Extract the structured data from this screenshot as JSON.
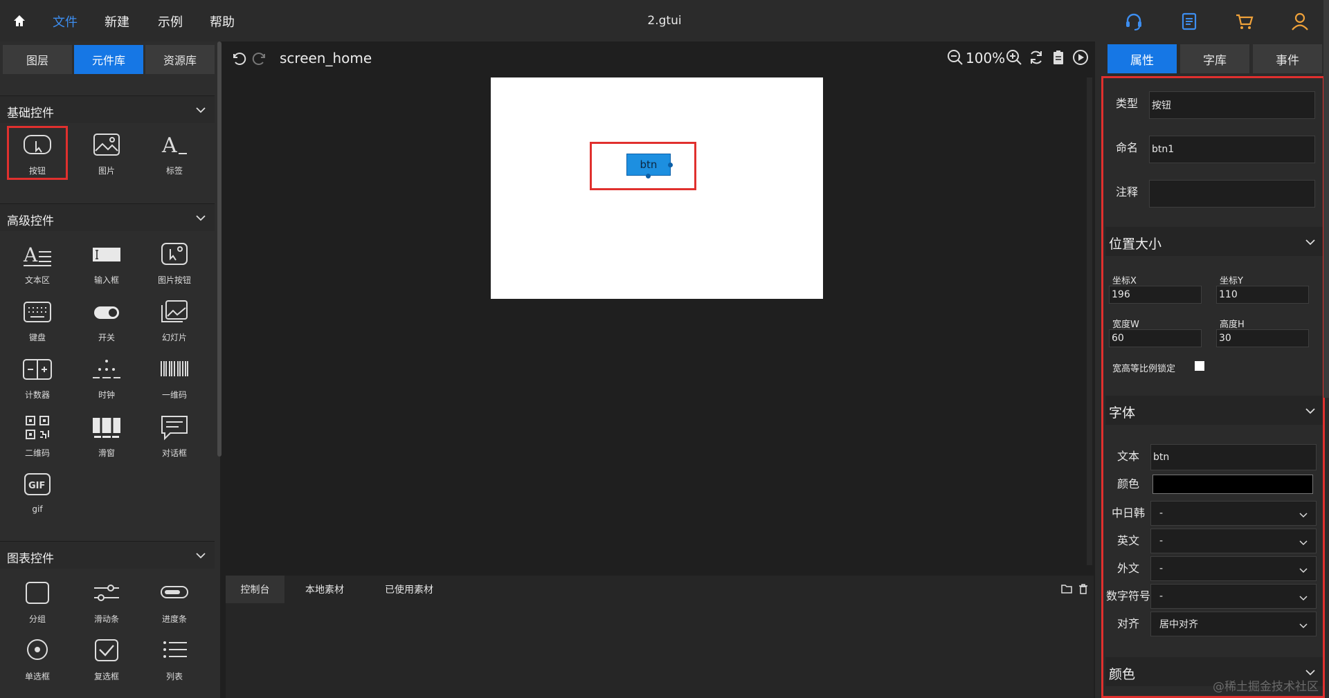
{
  "topbar": {
    "menus": [
      "文件",
      "新建",
      "示例",
      "帮助"
    ],
    "title": "2.gtui",
    "accent_color": "#3d8ef0"
  },
  "left": {
    "tabs": [
      "图层",
      "元件库",
      "资源库"
    ],
    "sections": {
      "basic": {
        "title": "基础控件",
        "items": [
          {
            "label": "按钮",
            "icon": "button-icon"
          },
          {
            "label": "图片",
            "icon": "image-icon"
          },
          {
            "label": "标签",
            "icon": "label-icon"
          }
        ]
      },
      "advanced": {
        "title": "高级控件",
        "items": [
          {
            "label": "文本区",
            "icon": "textarea-icon"
          },
          {
            "label": "输入框",
            "icon": "input-icon"
          },
          {
            "label": "图片按钮",
            "icon": "image-button-icon"
          },
          {
            "label": "键盘",
            "icon": "keyboard-icon"
          },
          {
            "label": "开关",
            "icon": "switch-icon"
          },
          {
            "label": "幻灯片",
            "icon": "slideshow-icon"
          },
          {
            "label": "计数器",
            "icon": "counter-icon"
          },
          {
            "label": "时钟",
            "icon": "clock-icon"
          },
          {
            "label": "一维码",
            "icon": "barcode-icon"
          },
          {
            "label": "二维码",
            "icon": "qrcode-icon"
          },
          {
            "label": "滑窗",
            "icon": "slider-window-icon"
          },
          {
            "label": "对话框",
            "icon": "dialog-icon"
          },
          {
            "label": "gif",
            "icon": "gif-icon"
          }
        ]
      },
      "chart": {
        "title": "图表控件",
        "items": [
          {
            "label": "分组",
            "icon": "group-icon"
          },
          {
            "label": "滑动条",
            "icon": "slider-icon"
          },
          {
            "label": "进度条",
            "icon": "progress-icon"
          },
          {
            "label": "单选框",
            "icon": "radio-icon"
          },
          {
            "label": "复选框",
            "icon": "checkbox-icon"
          },
          {
            "label": "列表",
            "icon": "list-icon"
          }
        ]
      }
    }
  },
  "center": {
    "screen_name": "screen_home",
    "zoom": "100%",
    "button_text": "btn",
    "console_tabs": [
      "控制台",
      "本地素材",
      "已使用素材"
    ]
  },
  "right": {
    "tabs": [
      "属性",
      "字库",
      "事件"
    ],
    "type_label": "类型",
    "type_value": "按钮",
    "name_label": "命名",
    "name_value": "btn1",
    "note_label": "注释",
    "note_value": "",
    "pos_section": "位置大小",
    "x_label": "坐标X",
    "x_value": "196",
    "y_label": "坐标Y",
    "y_value": "110",
    "w_label": "宽度W",
    "w_value": "60",
    "h_label": "高度H",
    "h_value": "30",
    "lock_label": "宽高等比例锁定",
    "font_section": "字体",
    "text_label": "文本",
    "text_value": "btn",
    "color_label": "颜色",
    "color_value": "#000000",
    "cjk_label": "中日韩",
    "cjk_value": "-",
    "en_label": "英文",
    "en_value": "-",
    "foreign_label": "外文",
    "foreign_value": "-",
    "digit_label": "数字符号",
    "digit_value": "-",
    "align_label": "对齐",
    "align_value": "居中对齐",
    "color_section": "颜色"
  },
  "watermark": "@稀土掘金技术社区"
}
